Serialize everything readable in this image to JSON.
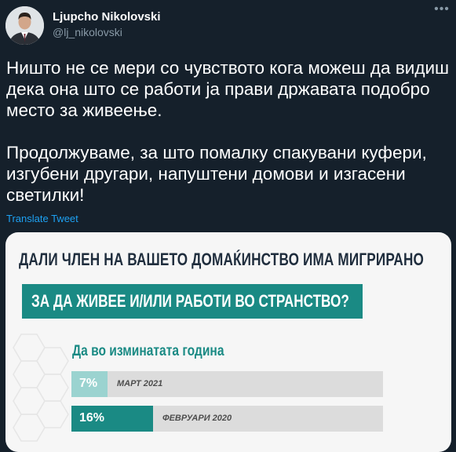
{
  "author": {
    "display_name": "Ljupcho Nikolovski",
    "handle": "@lj_nikolovski"
  },
  "tweet": {
    "paragraphs": [
      "Ништо не се мери со чувството кога можеш да видиш дека она што се работи ја прави државата подобро место за живеење.",
      "Продолжуваме, за што помалку спакувани куфери, изгубени другари, напуштени домови и изгасени светилки!"
    ],
    "translate_label": "Translate Tweet",
    "more_icon": "more-horizontal-icon"
  },
  "media": {
    "headline_line1": "ДАЛИ ЧЛЕН НА ВАШЕТО ДОМАЌИНСТВО ИМА МИГРИРАНО",
    "headline_line2": "ЗА ДА ЖИВЕЕ И/ИЛИ РАБОТИ ВО СТРАНСТВО?",
    "section_label": "Да во изминатата година",
    "bars": [
      {
        "value_label": "7%",
        "value": 7,
        "period": "МАРТ 2021"
      },
      {
        "value_label": "16%",
        "value": 16,
        "period": "ФЕВРУАРИ 2020"
      }
    ]
  },
  "colors": {
    "background": "#15202b",
    "accent": "#1a8a84",
    "accent_light": "#9bd3d0",
    "link": "#1da1f2",
    "muted": "#8899a6"
  }
}
